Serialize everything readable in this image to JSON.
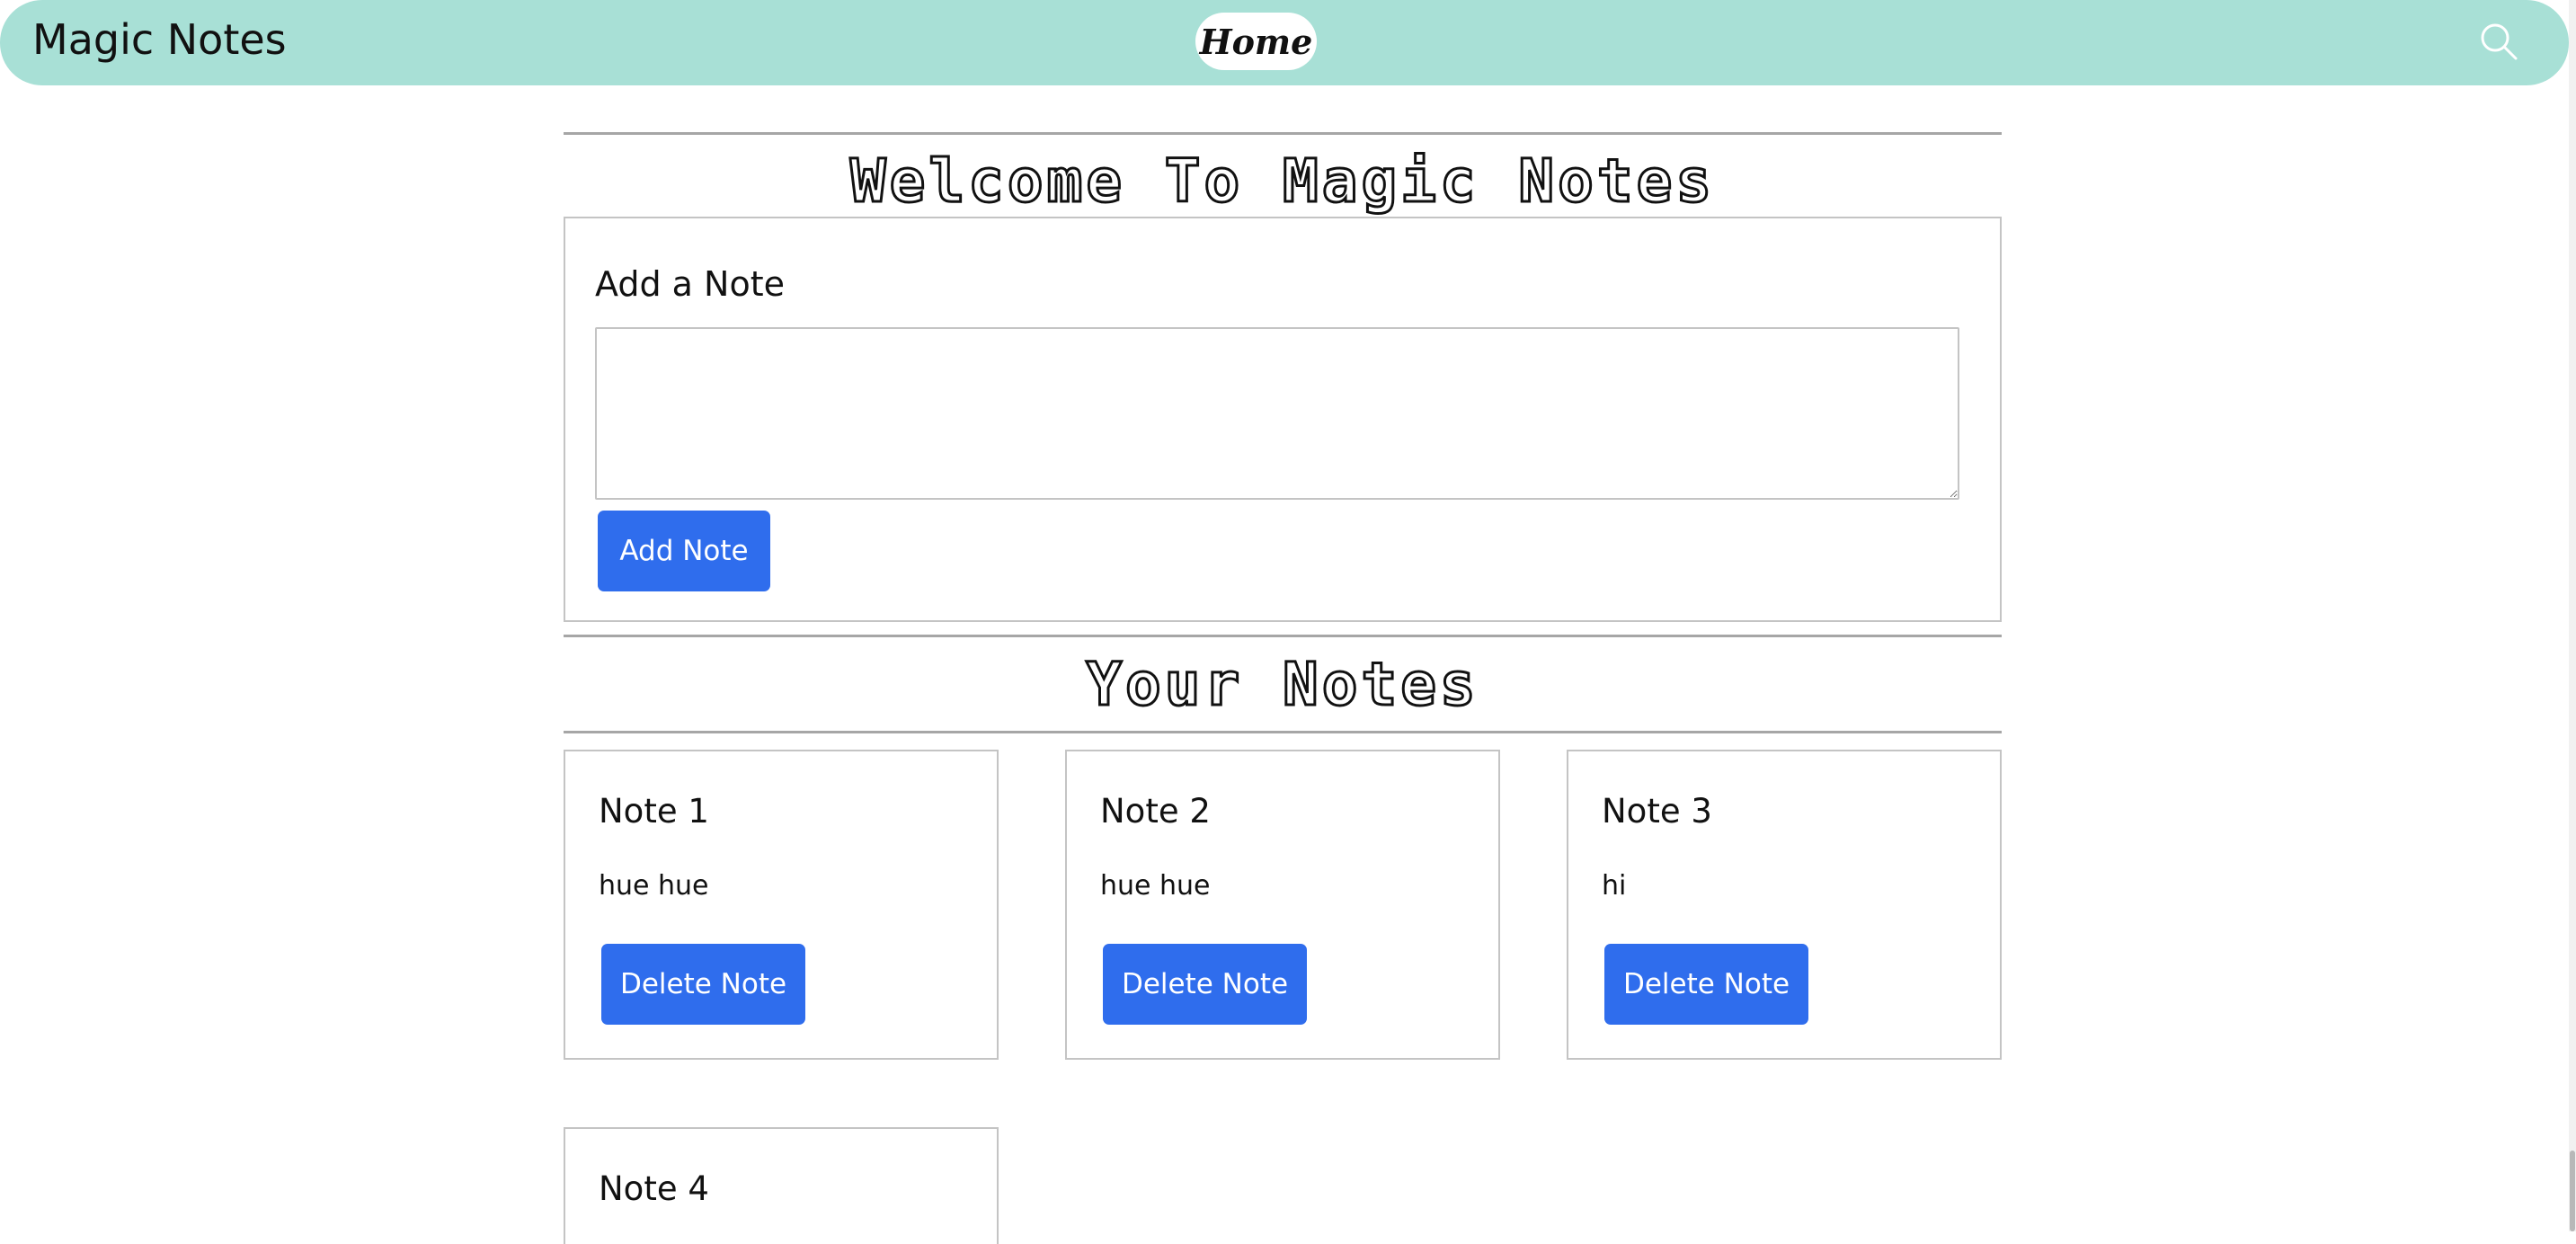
{
  "navbar": {
    "brand": "Magic Notes",
    "home_label": "Home",
    "search_icon": "search-icon",
    "background_color": "#a8e0d6"
  },
  "main": {
    "welcome_heading": "Welcome To Magic Notes",
    "add_card": {
      "title": "Add a Note",
      "textarea_value": "",
      "button_label": "Add Note"
    },
    "notes_heading": "Your Notes",
    "notes": [
      {
        "title": "Note 1",
        "text": "hue hue",
        "delete_label": "Delete Note"
      },
      {
        "title": "Note 2",
        "text": "hue hue",
        "delete_label": "Delete Note"
      },
      {
        "title": "Note 3",
        "text": "hi",
        "delete_label": "Delete Note"
      },
      {
        "title": "Note 4"
      }
    ]
  },
  "colors": {
    "accent_button": "#2f6ded",
    "card_border": "#c4c4c4"
  }
}
